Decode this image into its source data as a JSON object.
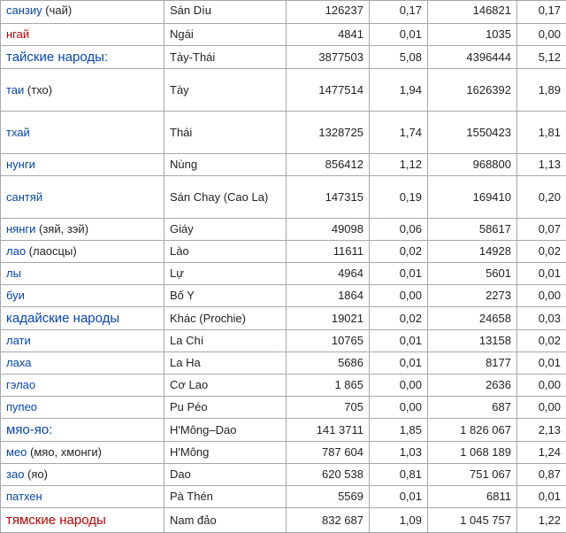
{
  "rows": [
    {
      "name": "санзиу",
      "note": " (чай)",
      "link": "blue",
      "vn": "Sán Dìu",
      "n1": "126237",
      "p1": "0,17",
      "n2": "146821",
      "p2": "0,17",
      "h": 26
    },
    {
      "name": "нгай",
      "note": "",
      "link": "red",
      "vn": "Ngái",
      "n1": "4841",
      "p1": "0,01",
      "n2": "1035",
      "p2": "0,00",
      "h": 25
    },
    {
      "name": "тайские народы:",
      "note": "",
      "link": "blue",
      "group": true,
      "vn": "Tày-Thái",
      "n1": "3877503",
      "p1": "5,08",
      "n2": "4396444",
      "p2": "5,12",
      "h": 26
    },
    {
      "name": "таи",
      "note": " (тхо)",
      "link": "blue",
      "vn": "Tày",
      "n1": "1477514",
      "p1": "1,94",
      "n2": "1626392",
      "p2": "1,89",
      "h": 48
    },
    {
      "name": "тхай",
      "note": "",
      "link": "blue",
      "vn": "Thái",
      "n1": "1328725",
      "p1": "1,74",
      "n2": "1550423",
      "p2": "1,81",
      "h": 48
    },
    {
      "name": "нунги",
      "note": "",
      "link": "blue",
      "vn": "Nùng",
      "n1": "856412",
      "p1": "1,12",
      "n2": "968800",
      "p2": "1,13",
      "h": 25
    },
    {
      "name": "сантяй",
      "note": "",
      "link": "blue",
      "vn": "Sán Chay (Cao La)",
      "n1": "147315",
      "p1": "0,19",
      "n2": "169410",
      "p2": "0,20",
      "h": 48
    },
    {
      "name": "нянги",
      "note": " (зяй, зэй)",
      "link": "blue",
      "vn": "Giáy",
      "n1": "49098",
      "p1": "0,06",
      "n2": "58617",
      "p2": "0,07",
      "h": 25
    },
    {
      "name": "лао",
      "note": " (лаосцы)",
      "link": "blue",
      "vn": "Lào",
      "n1": "11611",
      "p1": "0,02",
      "n2": "14928",
      "p2": "0,02",
      "h": 24
    },
    {
      "name": "лы",
      "note": "",
      "link": "blue",
      "vn": "Lự",
      "n1": "4964",
      "p1": "0,01",
      "n2": "5601",
      "p2": "0,01",
      "h": 24
    },
    {
      "name": "буи",
      "note": "",
      "link": "blue",
      "vn": "Bố Y",
      "n1": "1864",
      "p1": "0,00",
      "n2": "2273",
      "p2": "0,00",
      "h": 25
    },
    {
      "name": "кадайские народы",
      "note": "",
      "link": "blue",
      "group": true,
      "vn": "Khác (Prochie)",
      "n1": "19021",
      "p1": "0,02",
      "n2": "24658",
      "p2": "0,03",
      "h": 26
    },
    {
      "name": "лати",
      "note": "",
      "link": "blue",
      "vn": "La Chí",
      "n1": "10765",
      "p1": "0,01",
      "n2": "13158",
      "p2": "0,02",
      "h": 24
    },
    {
      "name": "лаха",
      "note": "",
      "link": "blue",
      "vn": "La Ha",
      "n1": "5686",
      "p1": "0,01",
      "n2": "8177",
      "p2": "0,01",
      "h": 25
    },
    {
      "name": "гэлао",
      "note": "",
      "link": "blue",
      "vn": "Cơ Lao",
      "n1": "1 865",
      "p1": "0,00",
      "n2": "2636",
      "p2": "0,00",
      "h": 25
    },
    {
      "name": "пупео",
      "note": "",
      "link": "blue",
      "vn": "Pu Péo",
      "n1": "705",
      "p1": "0,00",
      "n2": "687",
      "p2": "0,00",
      "h": 25
    },
    {
      "name": "мяо-яо:",
      "note": "",
      "link": "blue",
      "group": true,
      "vn": "H'Mông–Dao",
      "n1": "141 3711",
      "p1": "1,85",
      "n2": "1 826 067",
      "p2": "2,13",
      "h": 26
    },
    {
      "name": "мео",
      "note": " (мяо, хмонги)",
      "link": "blue",
      "vn": "H'Mông",
      "n1": "787 604",
      "p1": "1,03",
      "n2": "1 068 189",
      "p2": "1,24",
      "h": 25
    },
    {
      "name": "зао",
      "note": " (яо)",
      "link": "blue",
      "vn": "Dao",
      "n1": "620 538",
      "p1": "0,81",
      "n2": "751 067",
      "p2": "0,87",
      "h": 25
    },
    {
      "name": "патхен",
      "note": "",
      "link": "blue",
      "vn": "Pà Thén",
      "n1": "5569",
      "p1": "0,01",
      "n2": "6811",
      "p2": "0,01",
      "h": 25
    },
    {
      "name": "тямские народы",
      "note": "",
      "link": "red",
      "group": true,
      "vn": "Nam đảo",
      "n1": "832 687",
      "p1": "1,09",
      "n2": "1 045 757",
      "p2": "1,22",
      "h": 28
    }
  ]
}
